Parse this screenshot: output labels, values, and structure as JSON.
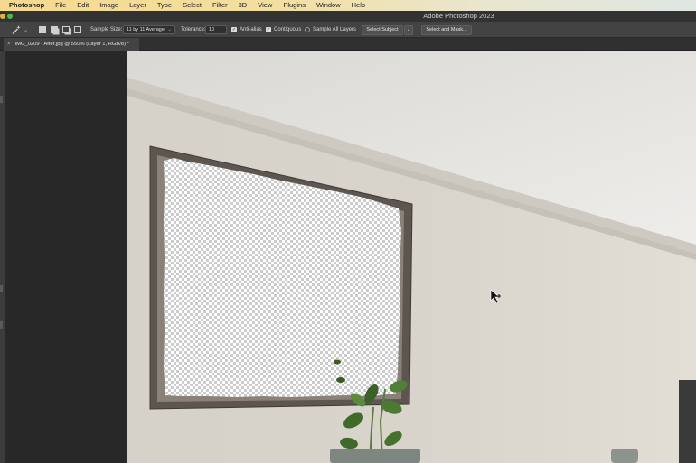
{
  "menubar": {
    "app": "Photoshop",
    "items": [
      "File",
      "Edit",
      "Image",
      "Layer",
      "Type",
      "Select",
      "Filter",
      "3D",
      "View",
      "Plugins",
      "Window",
      "Help"
    ]
  },
  "window": {
    "title": "Adobe Photoshop 2023"
  },
  "options": {
    "tool_icon": "magic-wand-icon",
    "sample_size_label": "Sample Size:",
    "sample_size_value": "11 by 11 Average",
    "tolerance_label": "Tolerance:",
    "tolerance_value": "10",
    "anti_alias_label": "Anti-alias",
    "anti_alias_checked": true,
    "contiguous_label": "Contiguous",
    "contiguous_checked": true,
    "sample_all_layers_label": "Sample All Layers",
    "sample_all_layers_checked": false,
    "select_subject_label": "Select Subject",
    "select_and_mask_label": "Select and Mask..."
  },
  "document_tab": {
    "title": "IMG_0209 - After.jpg @ 550% (Layer 1, RGB/8) *"
  },
  "colors": {
    "wall": "#dcd8d0",
    "ceiling": "#e6e5e2",
    "frame": "#5d5550",
    "panel_bg": "#282828",
    "options_bg": "#434343"
  }
}
